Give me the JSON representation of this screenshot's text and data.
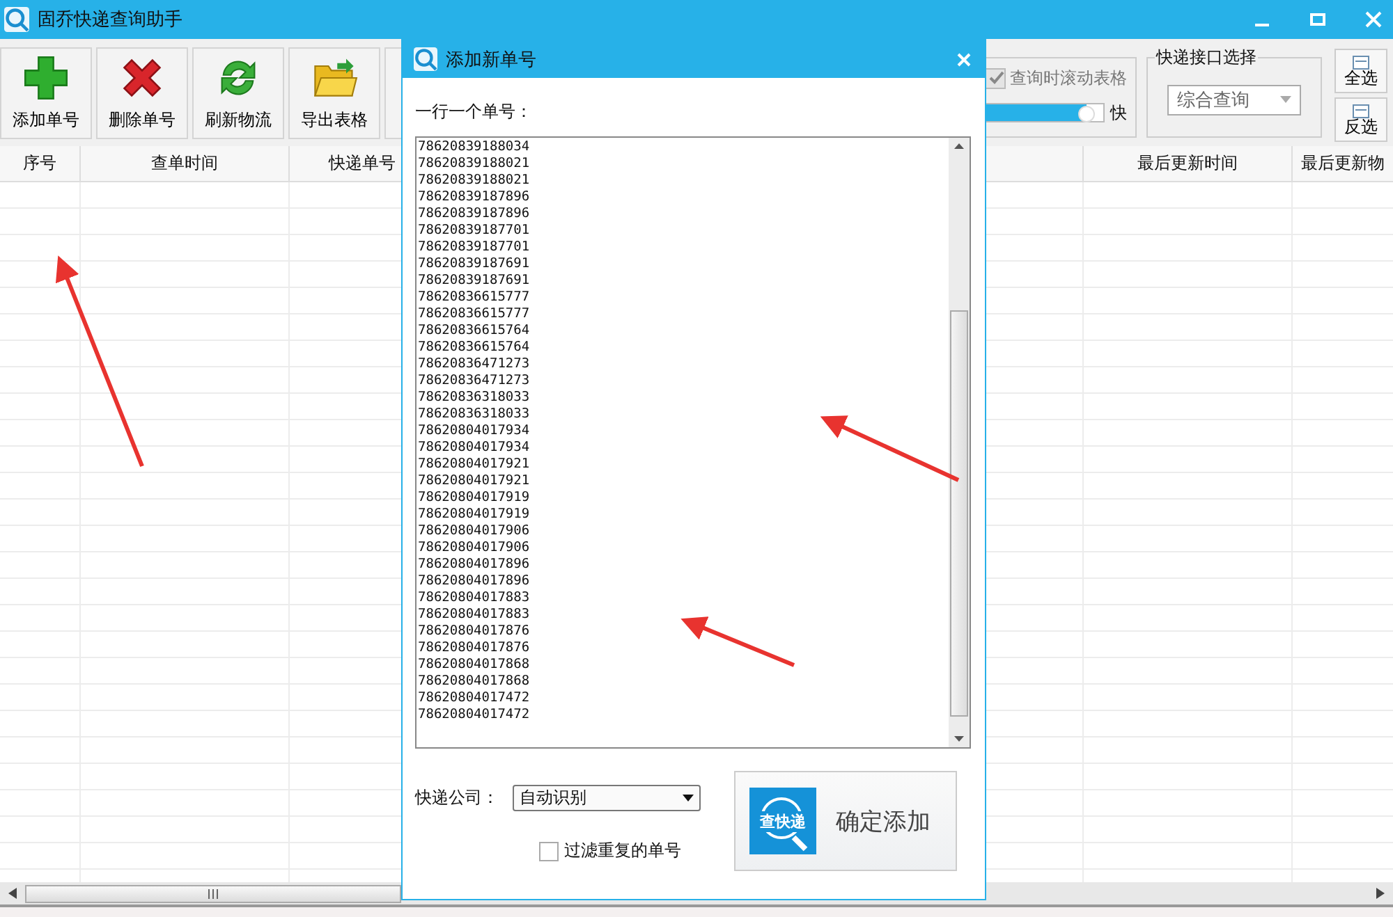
{
  "window": {
    "title": "固乔快递查询助手"
  },
  "toolbar": [
    {
      "kind": "add",
      "label": "添加单号"
    },
    {
      "kind": "delete",
      "label": "删除单号"
    },
    {
      "kind": "refresh",
      "label": "刷新物流"
    },
    {
      "kind": "export",
      "label": "导出表格"
    },
    {
      "kind": "hidden"
    }
  ],
  "scroll_option": {
    "label": "查询时滚动表格",
    "checked": true,
    "disabled": true,
    "level": 0.93,
    "fast_label": "快"
  },
  "api_group": {
    "title": "快递接口选择",
    "value": "综合查询"
  },
  "select_buttons": [
    {
      "label": "全选"
    },
    {
      "label": "反选"
    }
  ],
  "table": {
    "columns": [
      "序号",
      "查单时间",
      "快递单号",
      "",
      "最后更新时间",
      "最后更新物"
    ]
  },
  "dialog": {
    "title": "添加新单号",
    "prompt": "一行一个单号：",
    "numbers": [
      "78620839188034",
      "78620839188021",
      "78620839188021",
      "78620839187896",
      "78620839187896",
      "78620839187701",
      "78620839187701",
      "78620839187691",
      "78620839187691",
      "78620836615777",
      "78620836615777",
      "78620836615764",
      "78620836615764",
      "78620836471273",
      "78620836471273",
      "78620836318033",
      "78620836318033",
      "78620804017934",
      "78620804017934",
      "78620804017921",
      "78620804017921",
      "78620804017919",
      "78620804017919",
      "78620804017906",
      "78620804017906",
      "78620804017896",
      "78620804017896",
      "78620804017883",
      "78620804017883",
      "78620804017876",
      "78620804017876",
      "78620804017868",
      "78620804017868",
      "78620804017472",
      "78620804017472"
    ],
    "company_label": "快递公司：",
    "company_value": "自动识别",
    "filter": {
      "label": "过滤重复的单号",
      "checked": false
    },
    "confirm": {
      "logo_text": "查快递",
      "label": "确定添加"
    }
  }
}
